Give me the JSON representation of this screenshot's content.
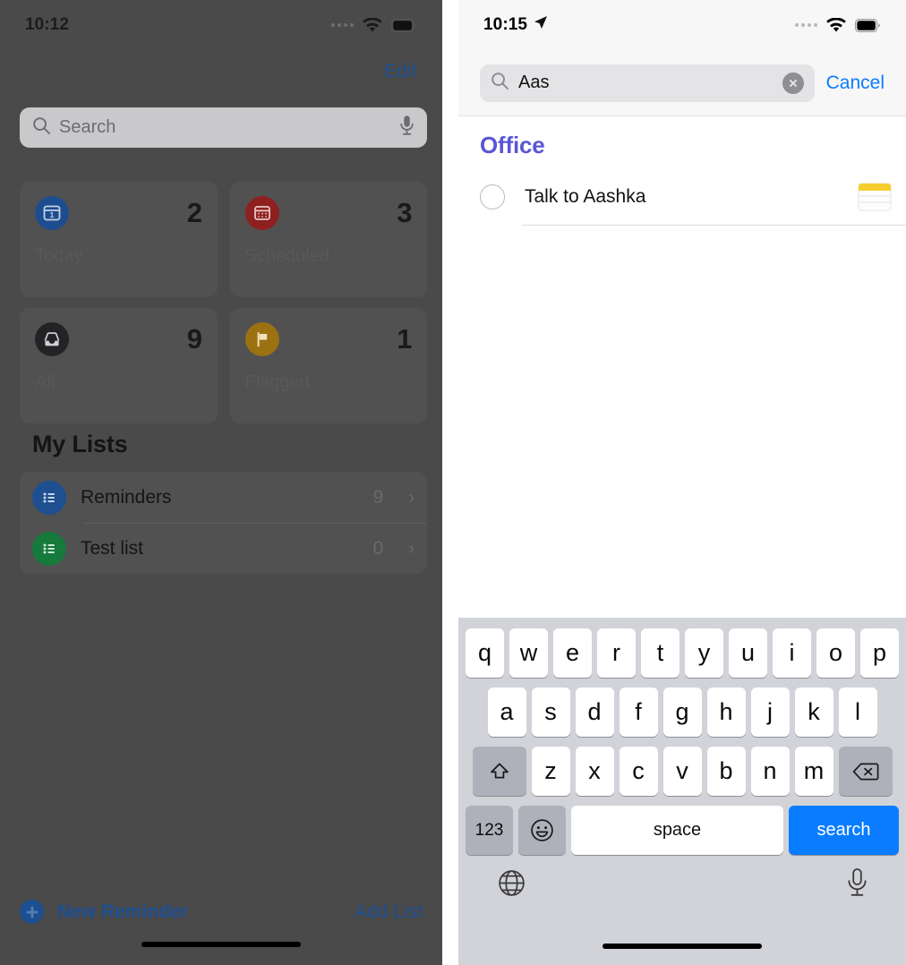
{
  "left_panel": {
    "status": {
      "time": "10:12",
      "wifi_icon": "wifi-icon",
      "battery_icon": "battery-icon",
      "signal_icon": "signal-dots-icon"
    },
    "edit_button": "Edit",
    "search": {
      "placeholder": "Search",
      "search_icon": "search-icon",
      "mic_icon": "microphone-icon"
    },
    "cards": [
      {
        "label": "Today",
        "count": "2",
        "icon": "calendar-today-icon",
        "color": "#1e4d8f"
      },
      {
        "label": "Scheduled",
        "count": "3",
        "icon": "calendar-icon",
        "color": "#8f2020"
      },
      {
        "label": "All",
        "count": "9",
        "icon": "inbox-tray-icon",
        "color": "#232326"
      },
      {
        "label": "Flagged",
        "count": "1",
        "icon": "flag-icon",
        "color": "#9b7111"
      }
    ],
    "my_lists_title": "My Lists",
    "lists": [
      {
        "name": "Reminders",
        "count": "9",
        "icon": "bulleted-list-icon",
        "color": "#1d4f91",
        "chevron": "›"
      },
      {
        "name": "Test list",
        "count": "0",
        "icon": "bulleted-list-icon",
        "color": "#157a3b",
        "chevron": "›"
      }
    ],
    "toolbar": {
      "new_reminder": "New Reminder",
      "add_list": "Add List",
      "plus_icon": "plus-circle-icon"
    }
  },
  "right_panel": {
    "status": {
      "time": "10:15",
      "location_icon": "location-arrow-icon",
      "wifi_icon": "wifi-icon",
      "battery_icon": "battery-icon",
      "signal_icon": "signal-dots-icon"
    },
    "search": {
      "value": "Aas",
      "placeholder": "Search",
      "search_icon": "search-icon",
      "clear_icon": "clear-circle-icon",
      "cancel_label": "Cancel"
    },
    "results": {
      "group_title": "Office",
      "group_color": "#5a56d6",
      "items": [
        {
          "title": "Talk to Aashka",
          "checkbox": "unchecked-circle-icon",
          "attachment_icon": "notes-app-icon"
        }
      ]
    },
    "keyboard": {
      "row1": [
        "q",
        "w",
        "e",
        "r",
        "t",
        "y",
        "u",
        "i",
        "o",
        "p"
      ],
      "row2": [
        "a",
        "s",
        "d",
        "f",
        "g",
        "h",
        "j",
        "k",
        "l"
      ],
      "row3": [
        "z",
        "x",
        "c",
        "v",
        "b",
        "n",
        "m"
      ],
      "shift_icon": "shift-arrow-icon",
      "delete_icon": "backspace-delete-icon",
      "numbers_key": "123",
      "emoji_icon": "emoji-smiley-icon",
      "space_key": "space",
      "return_key": "search",
      "globe_icon": "globe-language-icon",
      "dictation_icon": "microphone-icon",
      "accent_color": "#0a7cff"
    }
  }
}
